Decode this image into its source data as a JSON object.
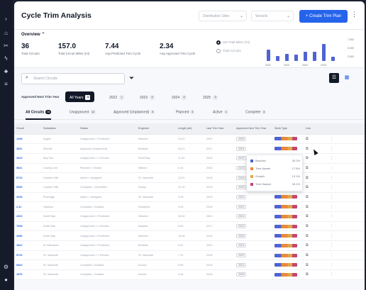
{
  "header": {
    "title": "Cycle Trim Analysis",
    "dropdown1": "Distribution Sites",
    "dropdown2": "Vessels",
    "create_button": "+ Create Trim Plan"
  },
  "overview": {
    "title": "Overview",
    "metrics": [
      {
        "value": "36",
        "label": "Total Circuits"
      },
      {
        "value": "157.0",
        "label": "Total Circuit Miles (mi)"
      },
      {
        "value": "7.44",
        "label": "Avg Predicted Trim Cycle"
      },
      {
        "value": "2.34",
        "label": "Avg Approved Trim Cycle"
      }
    ],
    "radio1": "Set Total Miles (mi)",
    "radio2": "Total Circuits",
    "chart_ticks": [
      "7,500",
      "5,000",
      "2,500"
    ],
    "chart_years": [
      "2022",
      "2023",
      "2024",
      "2025"
    ]
  },
  "chart_data": {
    "type": "bar",
    "categories": [
      "2022",
      "2023",
      "2024",
      "2025"
    ],
    "series": [
      {
        "values": [
          3200,
          1400,
          1900,
          1700,
          2500,
          2600,
          4800,
          1200
        ]
      }
    ],
    "ylim": [
      0,
      7500
    ]
  },
  "search": {
    "placeholder": "Search Circuits"
  },
  "years": {
    "label": "Approved Next Trim Year",
    "chips": [
      {
        "label": "All Years",
        "count": "36",
        "active": true
      },
      {
        "label": "2022",
        "count": "1"
      },
      {
        "label": "2023",
        "count": "5"
      },
      {
        "label": "2024",
        "count": "5"
      },
      {
        "label": "2025",
        "count": "5"
      }
    ]
  },
  "tabs": [
    {
      "label": "All Circuits",
      "count": "36"
    },
    {
      "label": "Unapproved",
      "count": "12"
    },
    {
      "label": "Approved (Unplanned)",
      "count": "5"
    },
    {
      "label": "Planned",
      "count": "3"
    },
    {
      "label": "Active",
      "count": "1"
    },
    {
      "label": "Complete",
      "count": "4"
    }
  ],
  "table": {
    "headers": [
      "Circuit",
      "Substation",
      "Status",
      "Engineer",
      "Length (mi)",
      "Last Trim Year",
      "Approved Next Trim Year",
      "Work Type",
      "Link",
      ""
    ],
    "rows": [
      [
        "1298",
        "Argyle",
        "Unapproved > Predicted",
        "Wesden",
        "13.01",
        "2020",
        "2025",
        "",
        "",
        ""
      ],
      [
        "3551",
        "Ellsville",
        "Approved (Unplanned)",
        "Bedside",
        "28.21",
        "2017",
        "2024",
        "",
        "",
        ""
      ],
      [
        "4324",
        "Bay Sun",
        "Unapproved > 1 Review",
        "Short Bay",
        "11.53",
        "2019",
        "2022",
        "",
        "",
        ""
      ],
      [
        "5841",
        "County Line",
        "Planned > Vendor",
        "Wilford",
        "6.14",
        "2016",
        "2023",
        "",
        "",
        ""
      ],
      [
        "5723",
        "Casden Hills",
        "Active > Assigned",
        "St. Vasworth",
        "12.51",
        "2018",
        "2024",
        "",
        "",
        ""
      ],
      [
        "6536",
        "Casden Hills",
        "Complete > Unverified",
        "Searly",
        "11.13",
        "2015",
        "2025",
        "",
        "",
        ""
      ],
      [
        "3245",
        "Pineridge",
        "Active > Assigned",
        "St. Vasworth",
        "3.05",
        "2019",
        "2022",
        "",
        "",
        ""
      ],
      [
        "2.41",
        "Harrison",
        "Complete > Audited",
        "Scattered",
        "4.26",
        "2014",
        "2022",
        "",
        "",
        ""
      ],
      [
        "2323",
        "North Bay",
        "Unapproved > Predicted",
        "Wesden",
        "16.04",
        "2020",
        "2024",
        "",
        "",
        ""
      ],
      [
        "7098",
        "North Bay",
        "Unapproved > 1 Review",
        "Bayside",
        "6.89",
        "2017",
        "2023",
        "",
        "",
        ""
      ],
      [
        "3456",
        "North Bay",
        "Unapproved > Predicted",
        "Wesden",
        "10.08",
        "2016",
        "2025",
        "",
        "",
        ""
      ],
      [
        "1822",
        "W. Allentown",
        "Unapproved > Predicted",
        "Bedside",
        "5.92",
        "2019",
        "2024",
        "",
        "",
        ""
      ],
      [
        "5723",
        "St. Vasworth",
        "Unapproved > 1 Review",
        "St. Vasworth",
        "7.12",
        "2018",
        "2022",
        "",
        "",
        ""
      ],
      [
        "6844",
        "St. Vasworth",
        "Complete > Audited",
        "Aurora",
        "8.06",
        "2016",
        "2023",
        "",
        "",
        ""
      ],
      [
        "1876",
        "St. Vasworth",
        "Complete > Audited",
        "Aurora",
        "9.46",
        "2015",
        "2025",
        "",
        "",
        ""
      ]
    ]
  },
  "popup": {
    "rows": [
      {
        "label": "Brushes",
        "pct": "30.2%",
        "color": "#4f63d2"
      },
      {
        "label": "Tree Assets",
        "pct": "17.6%",
        "color": "#e8893b"
      },
      {
        "label": "Growth",
        "pct": "13.1%",
        "color": "#e0a84c"
      },
      {
        "label": "Tree Hazard",
        "pct": "39.1%",
        "color": "#c2476f"
      }
    ]
  }
}
